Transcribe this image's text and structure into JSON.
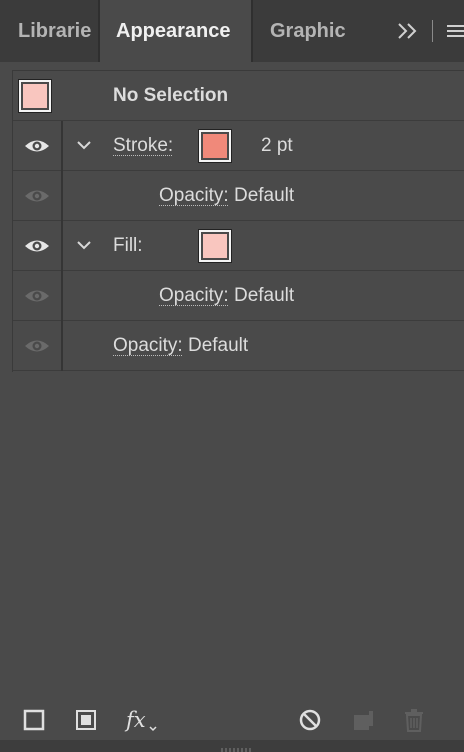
{
  "tabs": {
    "libraries": "Librarie",
    "appearance": "Appearance",
    "graphic": "Graphic"
  },
  "header_row": {
    "label": "No Selection",
    "swatch_color": "#f9c6bf"
  },
  "rows": [
    {
      "kind": "stroke",
      "label": "Stroke:",
      "value": "2 pt",
      "swatch_color": "#f0897a",
      "visible": true,
      "expanded": true
    },
    {
      "kind": "opacity",
      "label": "Opacity:",
      "value": "Default",
      "visible": false,
      "indent": true
    },
    {
      "kind": "fill",
      "label": "Fill:",
      "swatch_color": "#f9c6bf",
      "visible": true,
      "expanded": true
    },
    {
      "kind": "opacity",
      "label": "Opacity:",
      "value": "Default",
      "visible": false,
      "indent": true
    },
    {
      "kind": "opacity",
      "label": "Opacity:",
      "value": "Default",
      "visible": false,
      "indent": false
    }
  ],
  "toolbar": {
    "icons": [
      "add-new-stroke-icon",
      "add-new-fill-icon",
      "fx-icon",
      "clear-appearance-icon",
      "duplicate-item-icon",
      "delete-item-icon"
    ],
    "fx_label": "fx"
  },
  "colors": {
    "panel_bg": "#4a4a4a",
    "tab_bg": "#3b3b3b",
    "eye_visible": "#e6e6e6",
    "eye_hidden": "#6a6a6a"
  }
}
